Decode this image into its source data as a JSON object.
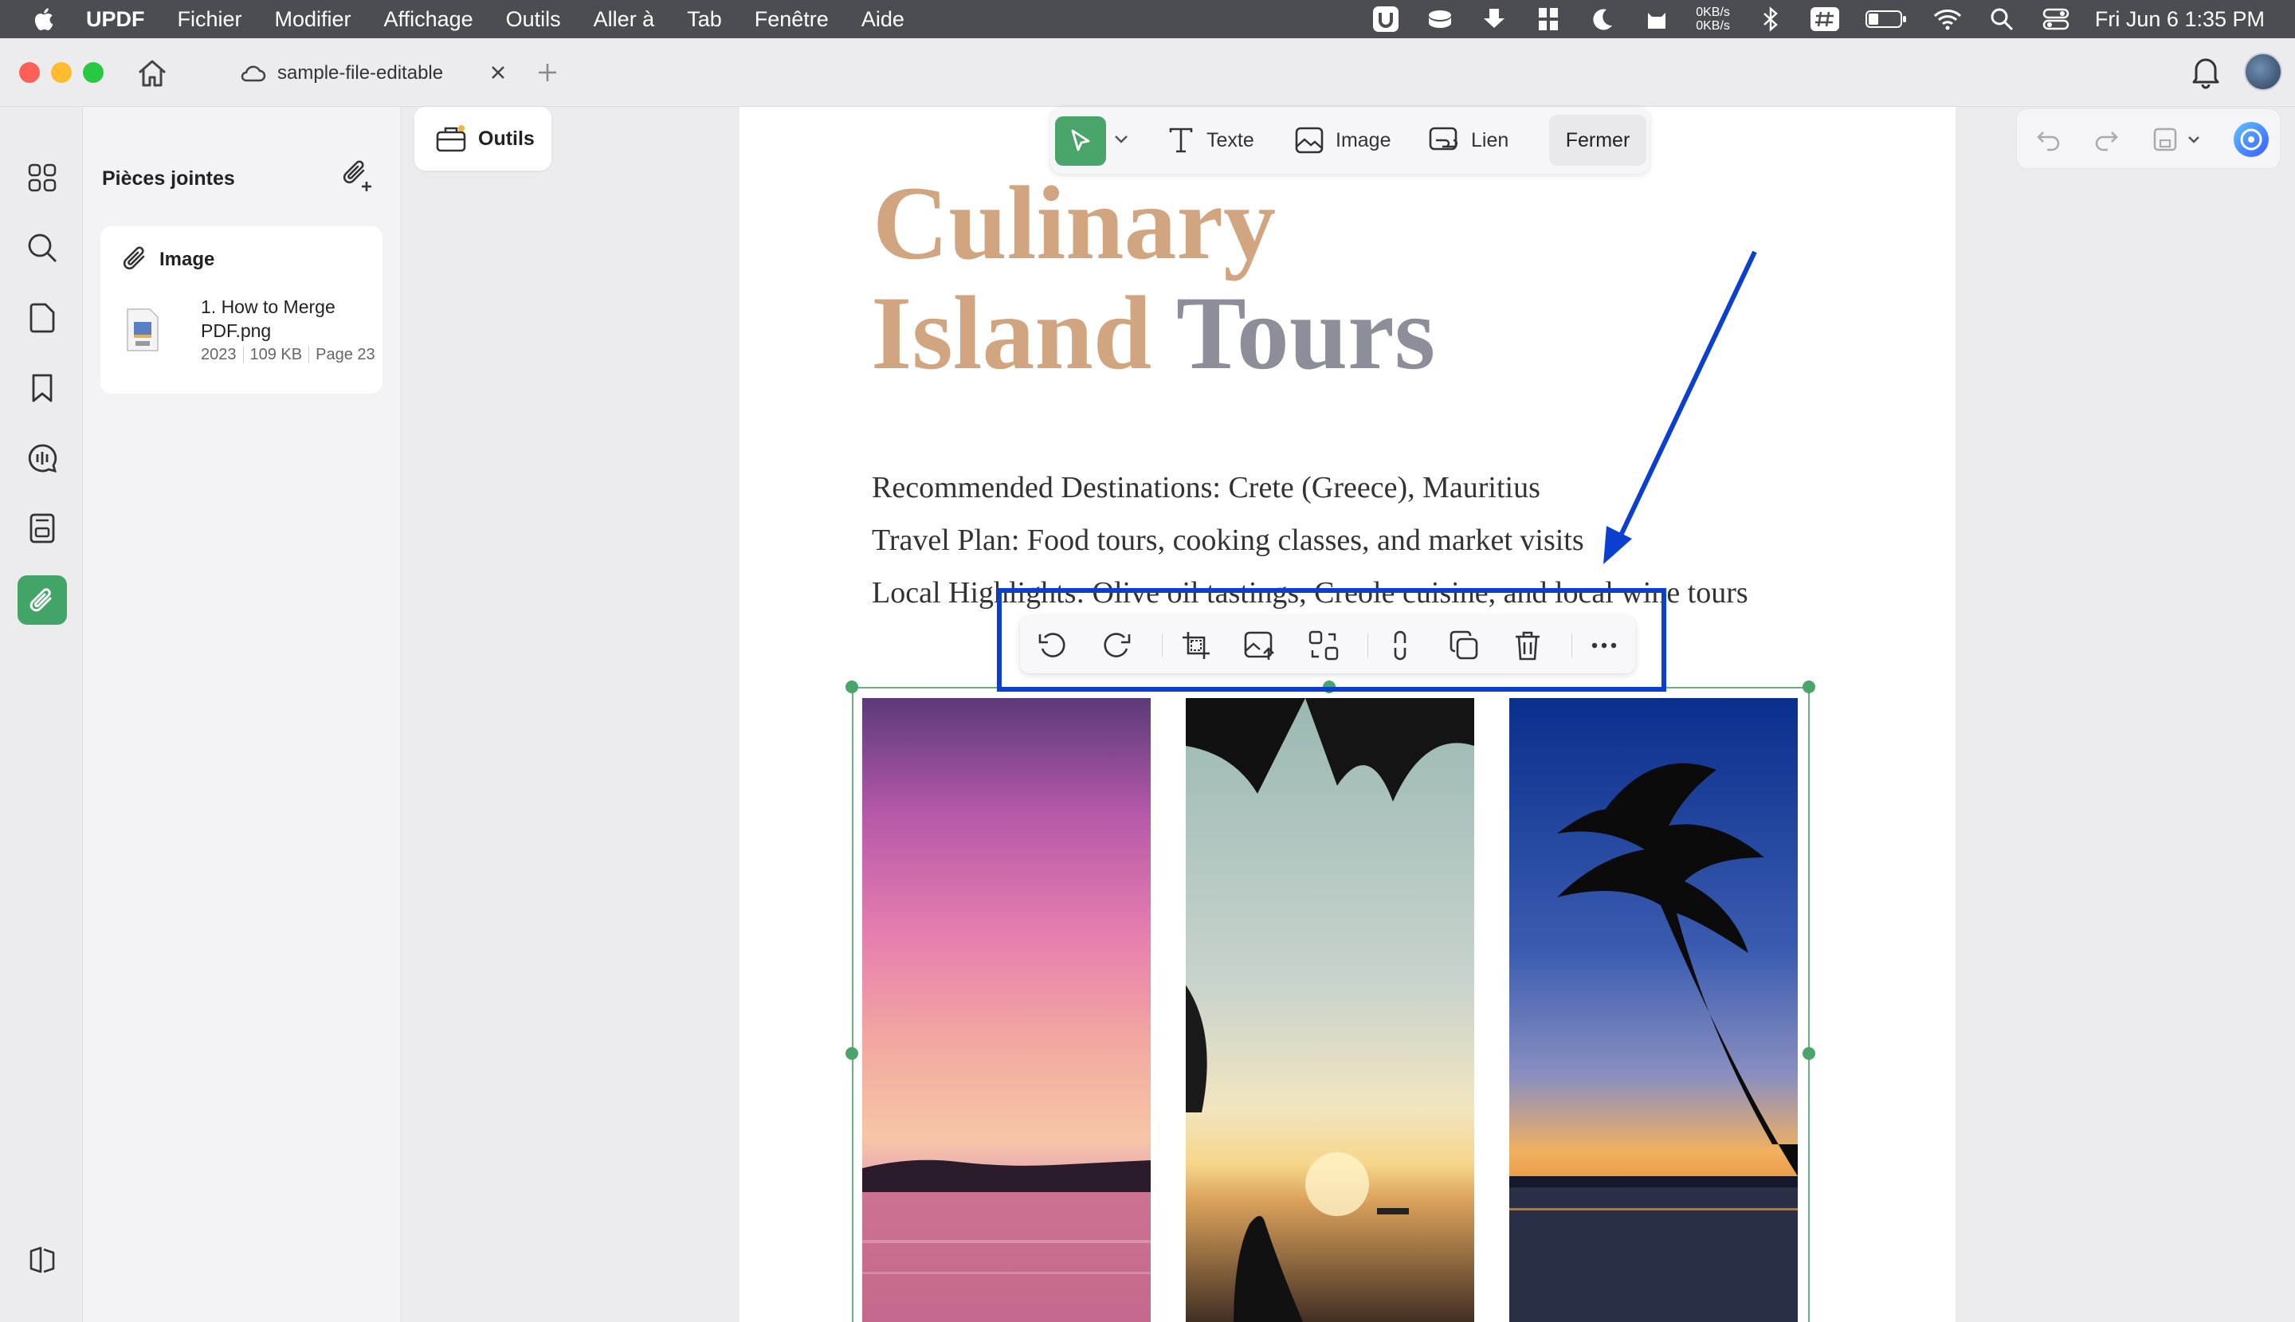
{
  "menubar": {
    "app_name": "UPDF",
    "items": [
      "Fichier",
      "Modifier",
      "Affichage",
      "Outils",
      "Aller à",
      "Tab",
      "Fenêtre",
      "Aide"
    ],
    "net_up": "0KB/s",
    "net_down": "0KB/s",
    "clock": "Fri Jun 6  1:35 PM"
  },
  "tab": {
    "title": "sample-file-editable"
  },
  "panel": {
    "title": "Pièces jointes",
    "card": {
      "type_label": "Image",
      "file_name": "1. How to Merge PDF.png",
      "year": "2023",
      "size": "109 KB",
      "page": "Page 23"
    }
  },
  "tools_button": {
    "label": "Outils"
  },
  "edit_toolbar": {
    "text_label": "Texte",
    "image_label": "Image",
    "link_label": "Lien",
    "close_label": "Fermer"
  },
  "document": {
    "title_line1": "Culinary",
    "title_line2_word1": "Island",
    "title_line2_word2": "Tours",
    "line1": "Recommended Destinations: Crete (Greece), Mauritius",
    "line2": "Travel Plan: Food tours, cooking classes, and market visits",
    "line3": "Local Highlights: Olive oil tastings, Creole cuisine, and local wine tours"
  },
  "image_toolbar": {
    "tools": [
      "rotate-left-icon",
      "rotate-right-icon",
      "crop-icon",
      "replace-image-icon",
      "extract-image-icon",
      "link-icon",
      "copy-icon",
      "delete-icon",
      "more-icon"
    ]
  },
  "colors": {
    "accent_green": "#43a467",
    "title_tan": "#d1a57f",
    "title_gray": "#8c8f99",
    "highlight_blue": "#0a3fcf"
  }
}
